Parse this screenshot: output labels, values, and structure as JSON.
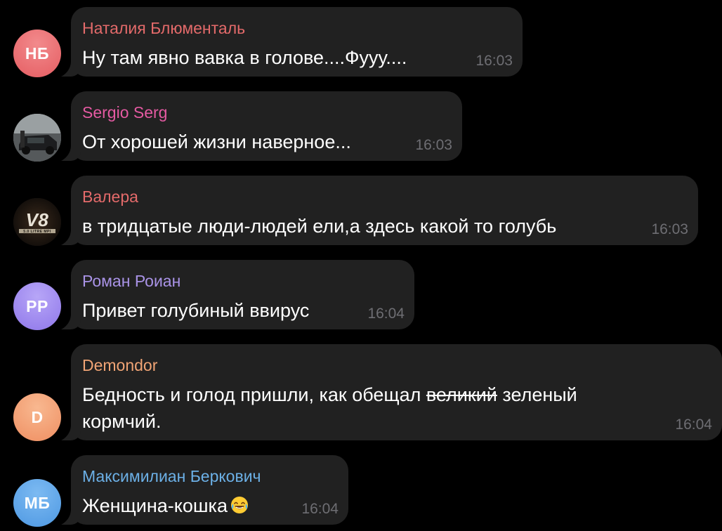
{
  "messages": [
    {
      "sender": "Наталия Блюменталь",
      "sender_color": "#e36a6a",
      "avatar": {
        "type": "initials",
        "initials": "НБ",
        "color": "#ec6f73"
      },
      "text": "Ну там явно вавка в голове....Фууу....",
      "time": "16:03"
    },
    {
      "sender": "Sergio Serg",
      "sender_color": "#e55aa2",
      "avatar": {
        "type": "photo",
        "icon": "car-photo-avatar"
      },
      "text": "От хорошей жизни наверное...",
      "time": "16:03"
    },
    {
      "sender": "Валера",
      "sender_color": "#e36a6a",
      "avatar": {
        "type": "photo",
        "icon": "v8-logo-avatar",
        "logo_text": "V8",
        "logo_subtext": "5.0 LITRE MPI"
      },
      "text": "в тридцатые люди-людей ели,а здесь какой то голубь",
      "time": "16:03"
    },
    {
      "sender": "Роман Роиан",
      "sender_color": "#a993e6",
      "avatar": {
        "type": "initials",
        "initials": "РР",
        "color": "#9f8af0"
      },
      "text": "Привет голубиный ввирус",
      "time": "16:04"
    },
    {
      "sender": "Demondor",
      "sender_color": "#f0a475",
      "avatar": {
        "type": "initials",
        "initials": "D",
        "color": "#f49f74"
      },
      "text_parts": {
        "before": "Бедность и голод пришли, как обещал ",
        "strike": "великий",
        "after": " зеленый",
        "line2": "кормчий."
      },
      "time": "16:04"
    },
    {
      "sender": "Максимилиан Беркович",
      "sender_color": "#6cb0e6",
      "avatar": {
        "type": "initials",
        "initials": "МБ",
        "color": "#5aa3e8"
      },
      "text": "Женщина-кошка",
      "emoji": "face-with-tears-of-joy-icon",
      "time": "16:04"
    }
  ]
}
